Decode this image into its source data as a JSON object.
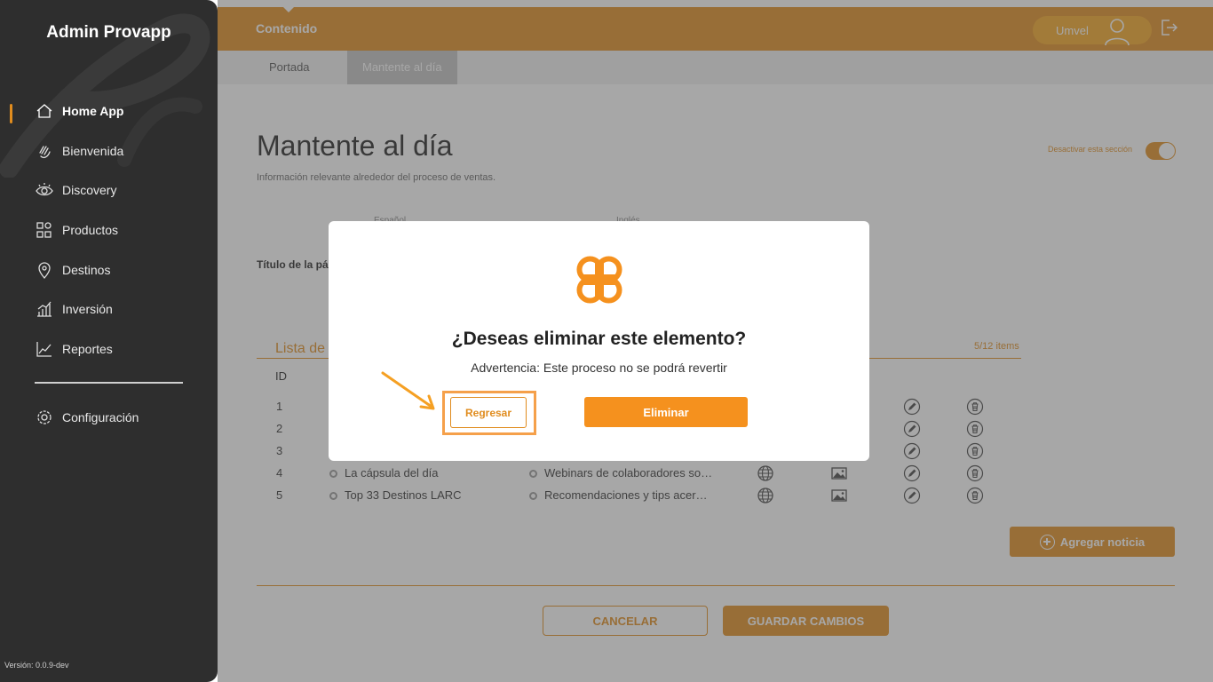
{
  "sidebar": {
    "brand": "Admin Provapp",
    "items": [
      {
        "label": "Home App",
        "icon": "home-icon"
      },
      {
        "label": "Bienvenida",
        "icon": "hand-wave-icon"
      },
      {
        "label": "Discovery",
        "icon": "eye-icon"
      },
      {
        "label": "Productos",
        "icon": "grid-icon"
      },
      {
        "label": "Destinos",
        "icon": "location-pin-icon"
      },
      {
        "label": "Inversión",
        "icon": "bar-chart-icon"
      },
      {
        "label": "Reportes",
        "icon": "line-chart-icon"
      }
    ],
    "config_label": "Configuración",
    "version": "Versión: 0.0.9-dev"
  },
  "topbar": {
    "title": "Contenido",
    "user": "Umvel"
  },
  "tabs": [
    {
      "label": "Portada"
    },
    {
      "label": "Mantente al día"
    }
  ],
  "page": {
    "title": "Mantente al día",
    "subtitle": "Información relevante alrededor del proceso de ventas.",
    "toggle_label": "Desactivar esta sección",
    "lang_es": "Español",
    "lang_en": "Inglés",
    "field_label": "Título de la pá",
    "list_title": "Lista de",
    "list_count": "5/12 items",
    "col_id": "ID",
    "rows": [
      {
        "id": "1",
        "c1": "",
        "c2": ""
      },
      {
        "id": "2",
        "c1": "",
        "c2": ""
      },
      {
        "id": "3",
        "c1": "",
        "c2": ""
      },
      {
        "id": "4",
        "c1": "La cápsula del día",
        "c2": "Webinars de colaboradores so…"
      },
      {
        "id": "5",
        "c1": "Top 33 Destinos LARC",
        "c2": "Recomendaciones y tips acer…"
      }
    ],
    "add_button": "Agregar noticia",
    "cancel_button": "CANCELAR",
    "save_button": "GUARDAR CAMBIOS"
  },
  "modal": {
    "title": "¿Deseas eliminar este elemento?",
    "subtitle": "Advertencia: Este proceso no se podrá revertir",
    "back_button": "Regresar",
    "delete_button": "Eliminar"
  },
  "colors": {
    "accent": "#e08c1e",
    "sidebar_bg": "#2e2e2e",
    "modal_button": "#f5911e"
  }
}
